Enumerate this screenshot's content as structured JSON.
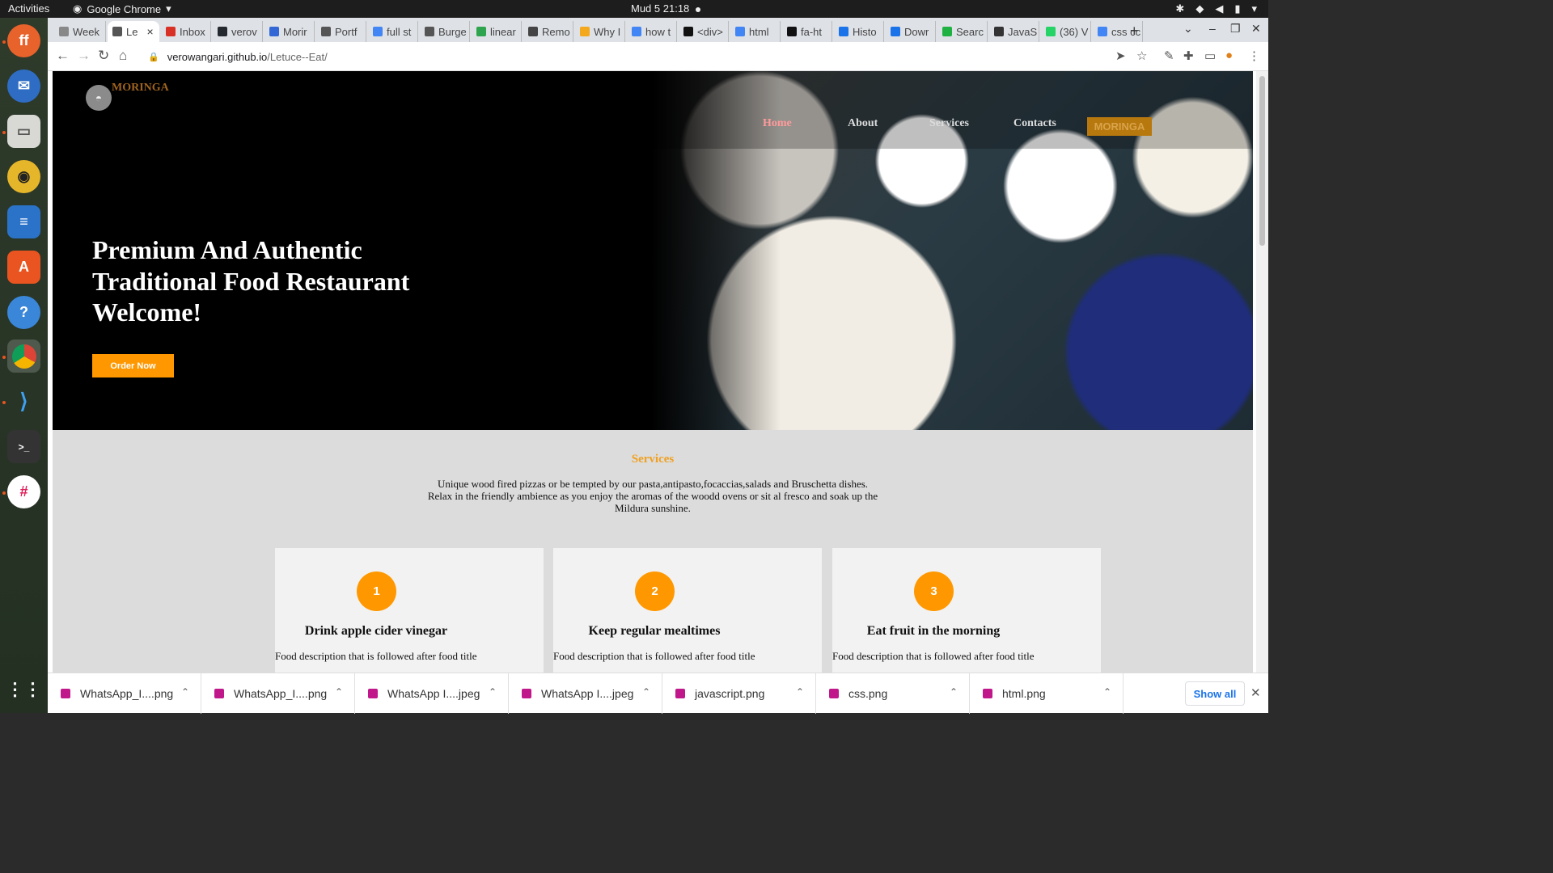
{
  "topbar": {
    "activities": "Activities",
    "app_name": "Google Chrome",
    "clock": "Mud 5  21:18"
  },
  "dock": {
    "apps": [
      "Firefox",
      "Thunderbird",
      "Files",
      "Rhythmbox",
      "LibreOffice Writer",
      "Ubuntu Software",
      "Help",
      "Google Chrome",
      "Visual Studio Code",
      "Terminal",
      "Slack",
      "Show Applications"
    ]
  },
  "browser": {
    "tabs": [
      {
        "label": "Week",
        "color": "#888888"
      },
      {
        "label": "Le",
        "color": "#555555",
        "active": true
      },
      {
        "label": "Inbox",
        "color": "#d93025"
      },
      {
        "label": "verov",
        "color": "#24292f"
      },
      {
        "label": "Morir",
        "color": "#3367d6"
      },
      {
        "label": "Portf",
        "color": "#555555"
      },
      {
        "label": "full st",
        "color": "#4285f4"
      },
      {
        "label": "Burge",
        "color": "#555555"
      },
      {
        "label": "linear",
        "color": "#2ea44f"
      },
      {
        "label": "Remo",
        "color": "#444444"
      },
      {
        "label": "Why I",
        "color": "#f4a81d"
      },
      {
        "label": "how t",
        "color": "#4285f4"
      },
      {
        "label": "<div>",
        "color": "#111111"
      },
      {
        "label": "html",
        "color": "#4285f4"
      },
      {
        "label": "fa-ht",
        "color": "#111111"
      },
      {
        "label": "Histo",
        "color": "#1a73e8"
      },
      {
        "label": "Dowr",
        "color": "#1a73e8"
      },
      {
        "label": "Searc",
        "color": "#1fb141"
      },
      {
        "label": "JavaS",
        "color": "#333333"
      },
      {
        "label": "(36) V",
        "color": "#25d366"
      },
      {
        "label": "css cc",
        "color": "#4285f4"
      }
    ],
    "close_glyph": "×",
    "new_tab_glyph": "+",
    "url_domain": "verowangari.github.io",
    "url_path": "/Letuce--Eat/"
  },
  "page": {
    "logo_text": "MORINGA",
    "nav": [
      "Home",
      "About",
      "Services",
      "Contacts"
    ],
    "nav_brand": "MORINGA",
    "hero_lines": [
      "Premium And Authentic",
      "Traditional Food Restaurant",
      "Welcome!"
    ],
    "order_button": "Order Now",
    "services_title": "Services",
    "services_lines": [
      "Unique wood fired pizzas or be tempted by our pasta,antipasto,focaccias,salads and Bruschetta dishes.",
      "Relax in the friendly ambience as you enjoy the aromas of the woodd ovens or sit al fresco and soak up the",
      "Mildura sunshine."
    ],
    "cards": [
      {
        "num": "1",
        "title": "Drink apple cider vinegar",
        "desc": "Food description that is followed after food title"
      },
      {
        "num": "2",
        "title": "Keep regular mealtimes",
        "desc": "Food description that is followed after food title"
      },
      {
        "num": "3",
        "title": "Eat fruit in the morning",
        "desc": "Food description that is followed after food title"
      }
    ]
  },
  "downloads": {
    "items": [
      "WhatsApp_I....png",
      "WhatsApp_I....png",
      "WhatsApp I....jpeg",
      "WhatsApp I....jpeg",
      "javascript.png",
      "css.png",
      "html.png"
    ],
    "show_all": "Show all"
  },
  "colors": {
    "accent_orange": "#ff9800",
    "services_title": "#f0a020",
    "logo_brown": "#a0631f",
    "download_icon": "#c0178a",
    "show_all_blue": "#1a73e8"
  }
}
